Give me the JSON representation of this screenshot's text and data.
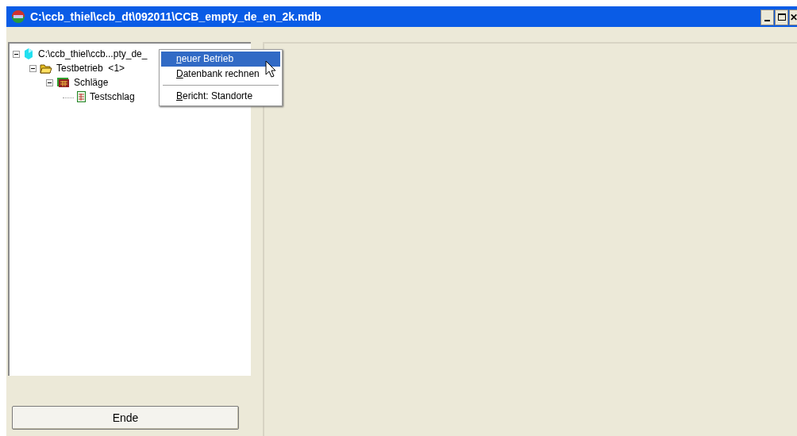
{
  "window": {
    "title": "C:\\ccb_thiel\\ccb_dt\\092011\\CCB_empty_de_en_2k.mdb",
    "close_button": "✕"
  },
  "tree": [
    {
      "label": "C:\\ccb_thiel\\ccb...pty_de_",
      "expanded": true,
      "children": [
        {
          "label": "Testbetrieb  <1>",
          "expanded": true,
          "children": [
            {
              "label": "Schläge",
              "expanded": true,
              "children": [
                {
                  "label": "Testschlag"
                }
              ]
            }
          ]
        }
      ]
    }
  ],
  "context_menu": [
    {
      "kind": "item",
      "label": "neuer Betrieb",
      "selected": true
    },
    {
      "kind": "item",
      "label": "Datenbank rechnen",
      "selected": false
    },
    {
      "kind": "separator"
    },
    {
      "kind": "item",
      "label": "Bericht: Standorte",
      "selected": false
    }
  ],
  "buttons": [
    "Ende"
  ]
}
